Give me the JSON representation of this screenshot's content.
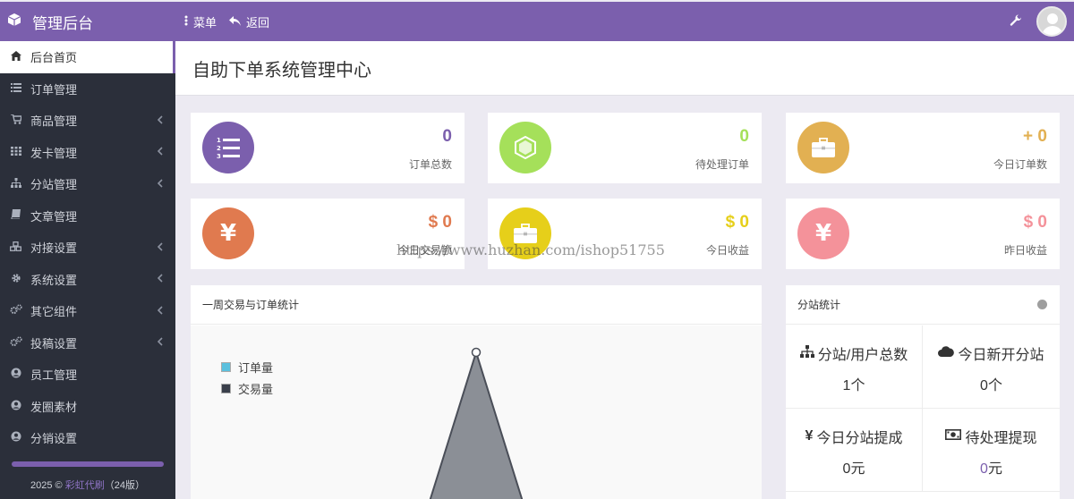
{
  "header": {
    "title": "管理后台",
    "menu_label": "菜单",
    "back_label": "返回",
    "brand_color": "#7b5fad"
  },
  "sidebar": {
    "items": [
      {
        "label": "后台首页",
        "icon": "home-icon",
        "active": true,
        "has_children": false
      },
      {
        "label": "订单管理",
        "icon": "list-icon",
        "active": false,
        "has_children": false
      },
      {
        "label": "商品管理",
        "icon": "cart-icon",
        "active": false,
        "has_children": true
      },
      {
        "label": "发卡管理",
        "icon": "grid-icon",
        "active": false,
        "has_children": true
      },
      {
        "label": "分站管理",
        "icon": "sitemap-icon",
        "active": false,
        "has_children": true
      },
      {
        "label": "文章管理",
        "icon": "book-icon",
        "active": false,
        "has_children": false
      },
      {
        "label": "对接设置",
        "icon": "cubes-icon",
        "active": false,
        "has_children": true
      },
      {
        "label": "系统设置",
        "icon": "gear-icon",
        "active": false,
        "has_children": true
      },
      {
        "label": "其它组件",
        "icon": "gears-icon",
        "active": false,
        "has_children": true
      },
      {
        "label": "投稿设置",
        "icon": "gears-icon",
        "active": false,
        "has_children": true
      },
      {
        "label": "员工管理",
        "icon": "user-circle-icon",
        "active": false,
        "has_children": false
      },
      {
        "label": "发圈素材",
        "icon": "user-circle-icon",
        "active": false,
        "has_children": false
      },
      {
        "label": "分销设置",
        "icon": "user-circle-icon",
        "active": false,
        "has_children": false
      }
    ],
    "copyright_year": "2025 ©",
    "copyright_brand": "彩虹代刷",
    "copyright_version": "（24版）"
  },
  "page": {
    "title": "自助下单系统管理中心"
  },
  "stats": [
    {
      "value": "0",
      "label": "订单总数",
      "color": "#7b5fad",
      "icon": "ordered-list-icon"
    },
    {
      "value": "0",
      "label": "待处理订单",
      "color": "#a5e05a",
      "icon": "hexagon-icon"
    },
    {
      "value": "+ 0",
      "label": "今日订单数",
      "color": "#e2b052",
      "icon": "briefcase-icon"
    },
    {
      "value": "$ 0",
      "label": "今日交易额",
      "color": "#e07a4f",
      "icon": "yen-icon"
    },
    {
      "value": "$ 0",
      "label": "今日收益",
      "color": "#e6cf1a",
      "icon": "briefcase-icon"
    },
    {
      "value": "$ 0",
      "label": "昨日收益",
      "color": "#f4929a",
      "icon": "yen-icon"
    }
  ],
  "weekly_panel": {
    "title": "一周交易与订单统计",
    "legend": [
      {
        "name": "订单量",
        "color": "#5bc0de"
      },
      {
        "name": "交易量",
        "color": "#3a3f4b"
      }
    ]
  },
  "substation_panel": {
    "title": "分站统计",
    "cells": [
      {
        "title": "分站/用户总数",
        "icon": "sitemap-icon",
        "value": "1个"
      },
      {
        "title": "今日新开分站",
        "icon": "cloud-icon",
        "value": "0个"
      },
      {
        "title": "今日分站提成",
        "icon": "yen-icon",
        "value": "0元"
      },
      {
        "title": "待处理提现",
        "icon": "money-icon",
        "value": "0",
        "unit": "元"
      }
    ]
  },
  "watermark": "https://www.huzhan.com/ishop51755"
}
